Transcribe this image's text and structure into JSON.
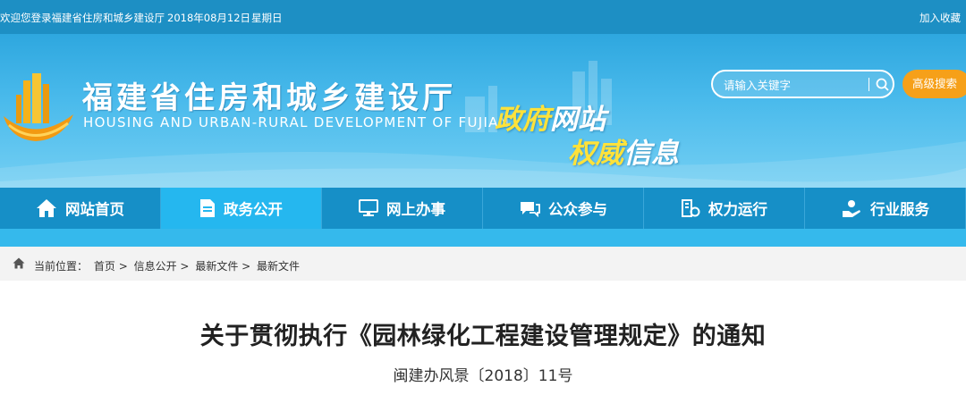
{
  "topbar": {
    "welcome": "欢迎您登录福建省住房和城乡建设厅",
    "date": "2018年08月12日",
    "weekday": "星期日",
    "favorite_label": "加入收藏"
  },
  "header": {
    "site_title": "福建省住房和城乡建设厅",
    "site_subtitle": "HOUSING AND URBAN-RURAL DEVELOPMENT OF FUJIAN",
    "slogan_line1_a": "政府",
    "slogan_line1_b": "网站",
    "slogan_line2_a": "权威",
    "slogan_line2_b": "信息",
    "search_placeholder": "请输入关键字",
    "advanced_search_label": "高级搜索"
  },
  "nav": {
    "items": [
      {
        "label": "网站首页",
        "icon": "home-icon"
      },
      {
        "label": "政务公开",
        "icon": "document-icon",
        "active": true
      },
      {
        "label": "网上办事",
        "icon": "monitor-icon"
      },
      {
        "label": "公众参与",
        "icon": "chat-icon"
      },
      {
        "label": "权力运行",
        "icon": "building-icon"
      },
      {
        "label": "行业服务",
        "icon": "service-icon"
      }
    ]
  },
  "breadcrumb": {
    "prefix": "当前位置：",
    "items": [
      "首页",
      "信息公开",
      "最新文件",
      "最新文件"
    ],
    "separator": ">"
  },
  "article": {
    "title": "关于贯彻执行《园林绿化工程建设管理规定》的通知",
    "doc_number": "闽建办风景〔2018〕11号"
  },
  "colors": {
    "topbar": "#1d8fc4",
    "nav": "#168fc7",
    "nav_active": "#25b7ef",
    "accent_orange": "#f6a019",
    "slogan_yellow": "#ffe23a"
  }
}
